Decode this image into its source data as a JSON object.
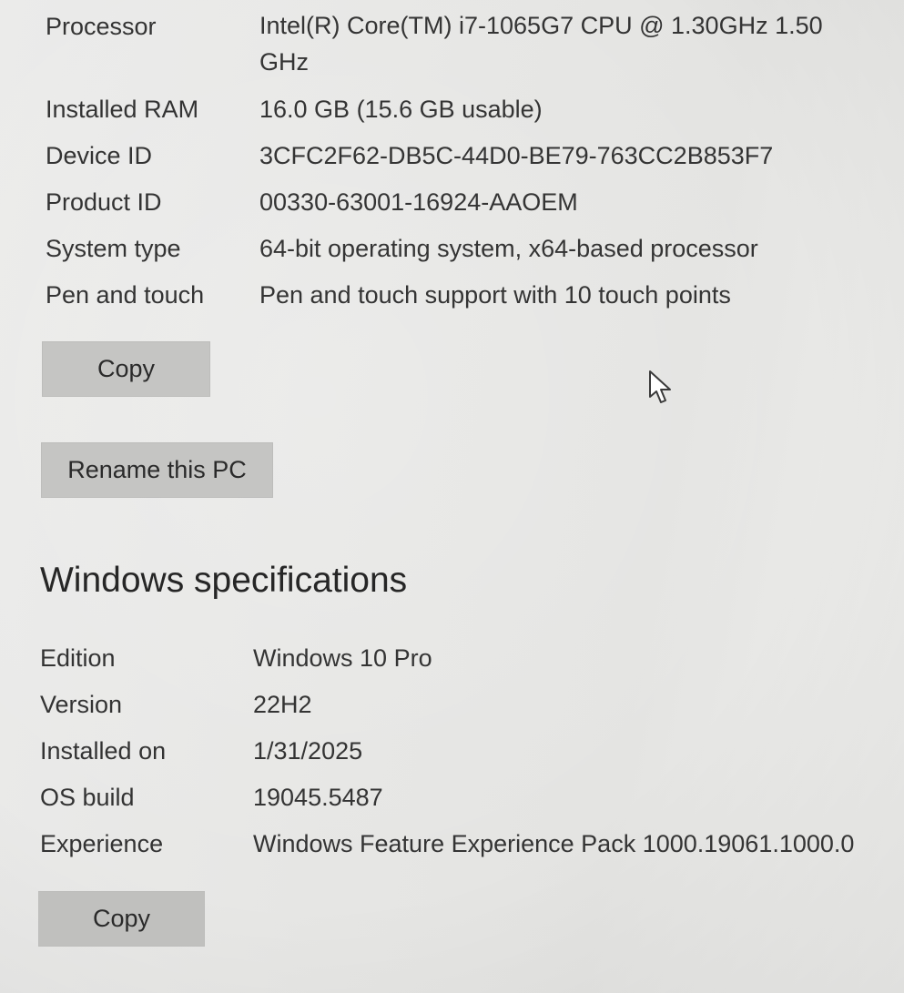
{
  "device_specifications": {
    "rows": [
      {
        "label": "Processor",
        "value": "Intel(R) Core(TM) i7-1065G7 CPU @ 1.30GHz   1.50 GHz"
      },
      {
        "label": "Installed RAM",
        "value": "16.0 GB (15.6 GB usable)"
      },
      {
        "label": "Device ID",
        "value": "3CFC2F62-DB5C-44D0-BE79-763CC2B853F7"
      },
      {
        "label": "Product ID",
        "value": "00330-63001-16924-AAOEM"
      },
      {
        "label": "System type",
        "value": "64-bit operating system, x64-based processor"
      },
      {
        "label": "Pen and touch",
        "value": "Pen and touch support with 10 touch points"
      }
    ],
    "copy_label": "Copy",
    "rename_label": "Rename this PC"
  },
  "windows_specifications": {
    "heading": "Windows specifications",
    "rows": [
      {
        "label": "Edition",
        "value": "Windows 10 Pro"
      },
      {
        "label": "Version",
        "value": "22H2"
      },
      {
        "label": "Installed on",
        "value": "1/31/2025"
      },
      {
        "label": "OS build",
        "value": "19045.5487"
      },
      {
        "label": "Experience",
        "value": "Windows Feature Experience Pack 1000.19061.1000.0"
      }
    ],
    "copy_label": "Copy"
  },
  "icons": {
    "cursor": "mouse-pointer-icon"
  },
  "colors": {
    "button_background": "#c5c5c3",
    "page_background": "#e8e8e6",
    "text": "#2e2e2e"
  }
}
